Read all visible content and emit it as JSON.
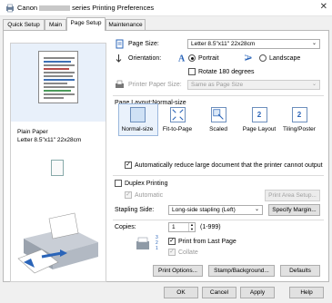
{
  "window": {
    "title_prefix": "Canon",
    "title_suffix": "series Printing Preferences",
    "close_glyph": "✕"
  },
  "tabs": [
    {
      "label": "Quick Setup"
    },
    {
      "label": "Main"
    },
    {
      "label": "Page Setup"
    },
    {
      "label": "Maintenance"
    }
  ],
  "preview": {
    "media_type": "Plain Paper",
    "paper_size": "Letter 8.5\"x11\" 22x28cm"
  },
  "page_setup": {
    "page_size_label": "Page Size:",
    "page_size_value": "Letter 8.5\"x11\" 22x28cm",
    "orientation_label": "Orientation:",
    "portrait_label": "Portrait",
    "landscape_label": "Landscape",
    "orientation_selected": "Portrait",
    "rotate_label": "Rotate 180 degrees",
    "printer_paper_size_label": "Printer Paper Size:",
    "printer_paper_size_value": "Same as Page Size",
    "layout_title": "Page Layout:Normal-size",
    "layouts": [
      {
        "label": "Normal-size",
        "icon": "normal-size-icon"
      },
      {
        "label": "Fit-to-Page",
        "icon": "fit-to-page-icon"
      },
      {
        "label": "Scaled",
        "icon": "scaled-icon"
      },
      {
        "label": "Page Layout",
        "icon": "page-layout-icon"
      },
      {
        "label": "Tiling/Poster",
        "icon": "tiling-poster-icon"
      }
    ],
    "layout_icon_numbers": [
      "2",
      "2"
    ],
    "auto_reduce_label": "Automatically reduce large document that the printer cannot output",
    "auto_reduce_checked": true,
    "duplex_label": "Duplex Printing",
    "duplex_checked": false,
    "automatic_label": "Automatic",
    "print_area_setup_label": "Print Area Setup...",
    "stapling_side_label": "Stapling Side:",
    "stapling_side_value": "Long-side stapling (Left)",
    "specify_margin_label": "Specify Margin...",
    "copies_label": "Copies:",
    "copies_value": "1",
    "copies_range": "(1-999)",
    "print_from_last_label": "Print from Last Page",
    "print_from_last_checked": true,
    "collate_label": "Collate",
    "collate_checked": true,
    "copies_icon_numbers": [
      "3",
      "2",
      "1"
    ],
    "print_options_label": "Print Options...",
    "stamp_background_label": "Stamp/Background...",
    "defaults_label": "Defaults"
  },
  "footer": {
    "ok_label": "OK",
    "cancel_label": "Cancel",
    "apply_label": "Apply",
    "help_label": "Help"
  },
  "colors": {
    "accent_blue": "#2a64b8",
    "preview_bg": "#e8f0fa",
    "check_mark": "✓"
  }
}
